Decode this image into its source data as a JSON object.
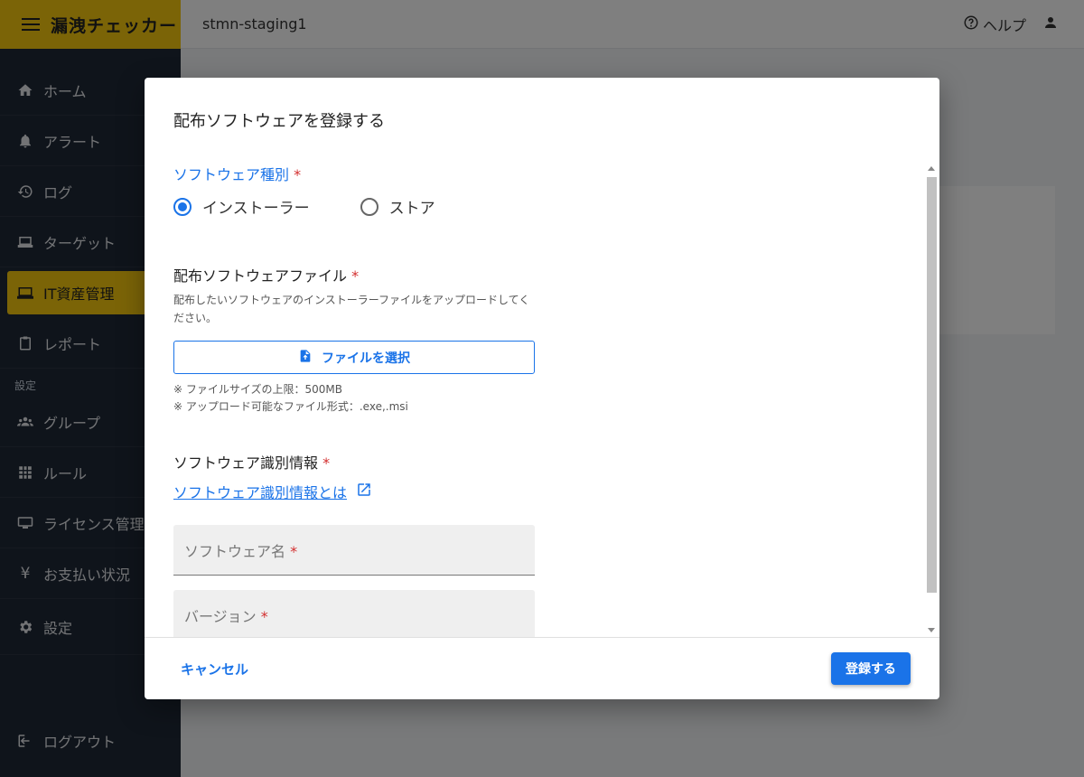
{
  "app": {
    "name": "漏洩チェッカー",
    "environment": "stmn-staging1"
  },
  "header": {
    "help_label": "ヘルプ"
  },
  "sidebar": {
    "items": [
      {
        "label": "ホーム",
        "icon": "home-icon"
      },
      {
        "label": "アラート",
        "icon": "bell-icon"
      },
      {
        "label": "ログ",
        "icon": "history-icon"
      },
      {
        "label": "ターゲット",
        "icon": "laptop-icon"
      },
      {
        "label": "IT資産管理",
        "icon": "monitor-icon",
        "active": true
      },
      {
        "label": "レポート",
        "icon": "clipboard-icon"
      }
    ],
    "settings_section_label": "設定",
    "settings_items": [
      {
        "label": "グループ",
        "icon": "group-icon"
      },
      {
        "label": "ルール",
        "icon": "grid-icon"
      },
      {
        "label": "ライセンス管理",
        "icon": "license-icon"
      },
      {
        "label": "お支払い状況",
        "icon": "yen-icon"
      },
      {
        "label": "設定",
        "icon": "gear-icon"
      }
    ],
    "logout_label": "ログアウト"
  },
  "dialog": {
    "title": "配布ソフトウェアを登録する",
    "software_type": {
      "label": "ソフトウェア種別",
      "required_mark": "*",
      "options": [
        {
          "label": "インストーラー",
          "selected": true
        },
        {
          "label": "ストア",
          "selected": false
        }
      ]
    },
    "file_section": {
      "label": "配布ソフトウェアファイル",
      "required_mark": "*",
      "description": "配布したいソフトウェアのインストーラーファイルをアップロードしてください。",
      "button_label": "ファイルを選択",
      "note_size": "※ ファイルサイズの上限：500MB",
      "note_formats": "※ アップロード可能なファイル形式：.exe,.msi"
    },
    "identification": {
      "label": "ソフトウェア識別情報",
      "required_mark": "*",
      "link_text": "ソフトウェア識別情報とは"
    },
    "fields": {
      "name_placeholder": "ソフトウェア名",
      "version_placeholder": "バージョン",
      "required_mark": "*"
    },
    "footer": {
      "cancel_label": "キャンセル",
      "submit_label": "登録する"
    }
  },
  "colors": {
    "accent": "#1a73e8",
    "brand": "#f6c90e",
    "sidebar_bg": "#1f2937",
    "required": "#d32f2f"
  }
}
